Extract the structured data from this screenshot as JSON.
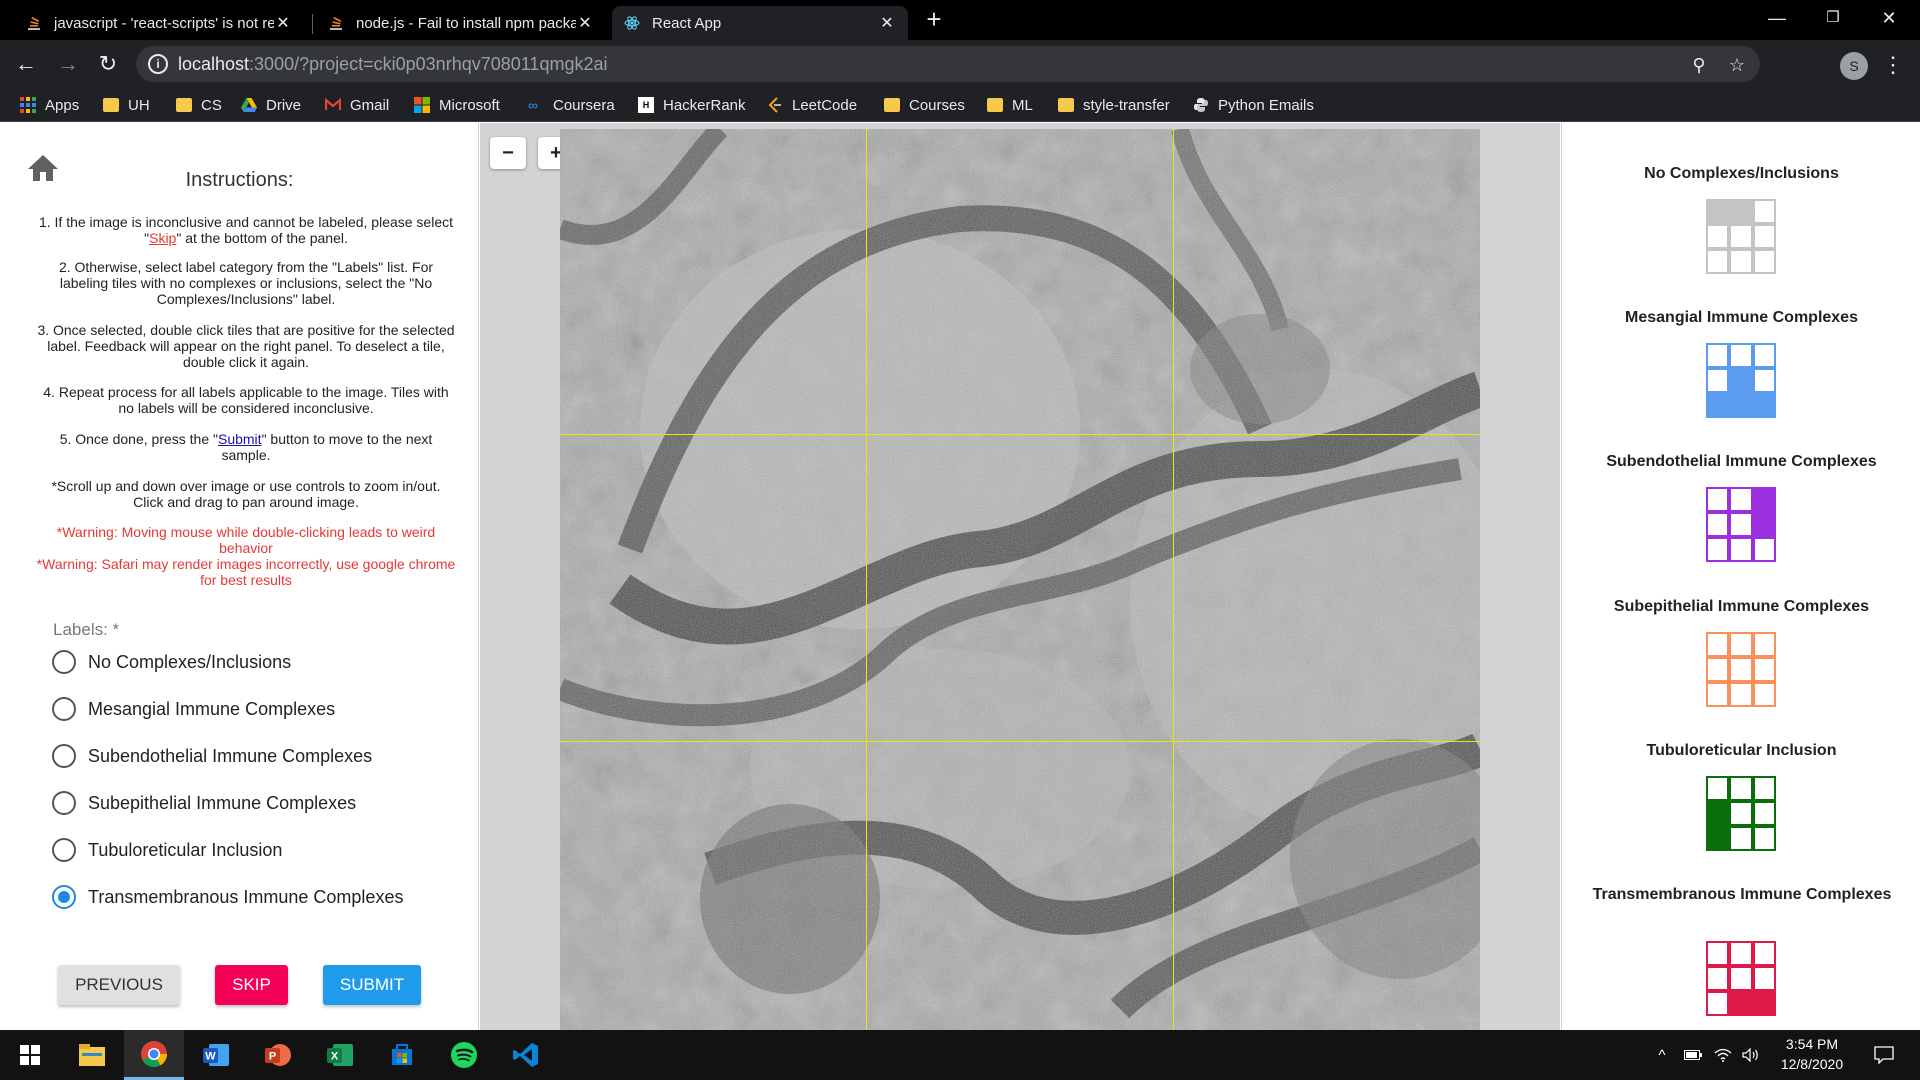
{
  "browser": {
    "tabs": [
      {
        "title": "javascript - 'react-scripts' is not re",
        "icon": "stackoverflow-icon"
      },
      {
        "title": "node.js - Fail to install npm packa",
        "icon": "stackoverflow-icon"
      },
      {
        "title": "React App",
        "icon": "react-icon"
      }
    ],
    "url_host": "localhost",
    "url_path": ":3000/?project=cki0p03nrhqv708011qmgk2ai",
    "profile_initial": "S",
    "bookmarks": [
      "Apps",
      "UH",
      "CS",
      "Drive",
      "Gmail",
      "Microsoft",
      "Coursera",
      "HackerRank",
      "LeetCode",
      "Courses",
      "ML",
      "style-transfer",
      "Python Emails"
    ]
  },
  "instructions": {
    "title": "Instructions:",
    "step1_pre": "1. If the image is inconclusive and cannot be labeled, please select \"",
    "step1_link": "Skip",
    "step1_post": "\" at the bottom of the panel.",
    "step2": "2. Otherwise, select label category from the \"Labels\" list. For labeling tiles with no complexes or inclusions, select the \"No Complexes/Inclusions\" label.",
    "step3": "3. Once selected, double click tiles that are positive for the selected label. Feedback will appear on the right panel. To deselect a tile, double click it again.",
    "step4": "4. Repeat process for all labels applicable to the image. Tiles with no labels will be considered inconclusive.",
    "step5_pre": "5. Once done, press the \"",
    "step5_link": "Submit",
    "step5_post": "\" button to move to the next sample.",
    "scroll_note": "*Scroll up and down over image or use controls to zoom in/out. Click and drag to pan around image.",
    "warning1": "*Warning: Moving mouse while double-clicking leads to weird behavior",
    "warning2": "*Warning: Safari may render images incorrectly, use google chrome for best results"
  },
  "labels": {
    "title": "Labels: *",
    "options": [
      {
        "label": "No Complexes/Inclusions",
        "checked": false
      },
      {
        "label": "Mesangial Immune Complexes",
        "checked": false
      },
      {
        "label": "Subendothelial Immune Complexes",
        "checked": false
      },
      {
        "label": "Subepithelial Immune Complexes",
        "checked": false
      },
      {
        "label": "Tubuloreticular Inclusion",
        "checked": false
      },
      {
        "label": "Transmembranous Immune Complexes",
        "checked": true
      }
    ]
  },
  "buttons": {
    "previous": "PREVIOUS",
    "skip": "SKIP",
    "submit": "SUBMIT"
  },
  "viewer": {
    "zoom_out": "−",
    "zoom_in": "+"
  },
  "legend": [
    {
      "title": "No Complexes/Inclusions",
      "color": "#c4c4c4",
      "filled": [
        0,
        1
      ]
    },
    {
      "title": "Mesangial Immune Complexes",
      "color": "#5b9cf0",
      "filled": [
        4,
        6,
        7,
        8
      ]
    },
    {
      "title": "Subendothelial Immune Complexes",
      "color": "#9b30e0",
      "filled": [
        2,
        5
      ]
    },
    {
      "title": "Subepithelial Immune Complexes",
      "color": "#f7925c",
      "filled": []
    },
    {
      "title": "Tubuloreticular Inclusion",
      "color": "#0a6e0a",
      "filled": [
        3,
        6
      ]
    },
    {
      "title": "Transmembranous Immune Complexes",
      "color": "#e0194b",
      "filled": [
        7,
        8
      ]
    }
  ],
  "taskbar": {
    "time": "3:54 PM",
    "date": "12/8/2020"
  }
}
